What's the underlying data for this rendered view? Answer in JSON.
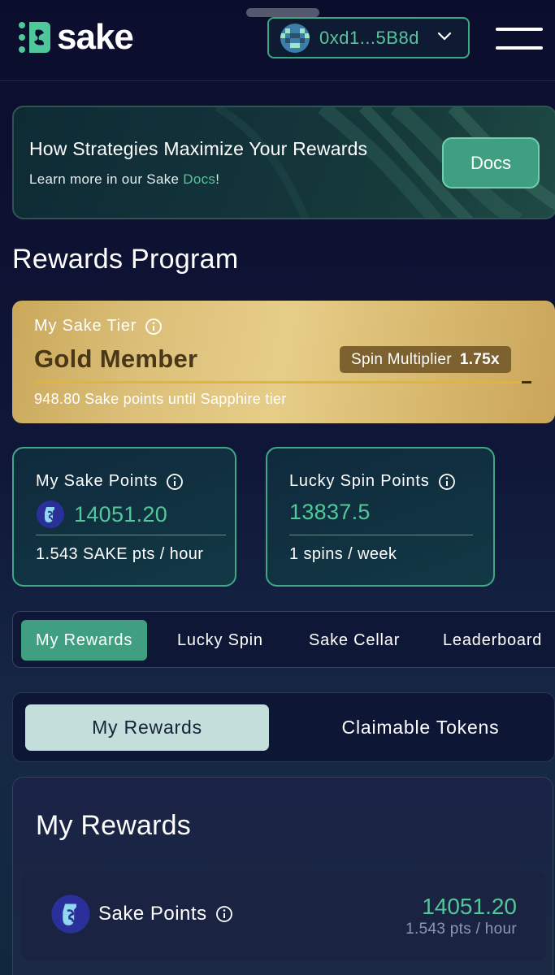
{
  "header": {
    "logo_text": "sake",
    "wallet_address": "0xd1...5B8d",
    "wallet_avatar": "pixel-avatar-icon",
    "menu_icon": "hamburger-menu-icon"
  },
  "banner": {
    "title": "How Strategies Maximize Your Rewards",
    "subtitle_prefix": "Learn more in our Sake ",
    "subtitle_link": "Docs",
    "subtitle_suffix": "!",
    "button_label": "Docs"
  },
  "section_title": "Rewards Program",
  "tier": {
    "label": "My Sake Tier",
    "name": "Gold Member",
    "multiplier_label": "Spin Multiplier",
    "multiplier_value": "1.75x",
    "progress_fraction": 0.98,
    "next_tier_text": "948.80 Sake points until Sapphire tier"
  },
  "points": {
    "sake": {
      "label": "My Sake Points",
      "value": "14051.20",
      "rate": "1.543 SAKE pts / hour"
    },
    "spin": {
      "label": "Lucky Spin Points",
      "value": "13837.5",
      "rate": "1 spins / week"
    }
  },
  "tabs": [
    "My Rewards",
    "Lucky Spin",
    "Sake Cellar",
    "Leaderboard"
  ],
  "subtabs": [
    "My Rewards",
    "Claimable Tokens"
  ],
  "rewards": {
    "title": "My Rewards",
    "items": [
      {
        "name": "Sake Points",
        "value": "14051.20",
        "rate": "1.543 pts / hour"
      }
    ]
  },
  "colors": {
    "accent": "#3f9f80",
    "accent_text": "#53c69a",
    "gold": "#dcc07a",
    "background": "#0d1030"
  }
}
